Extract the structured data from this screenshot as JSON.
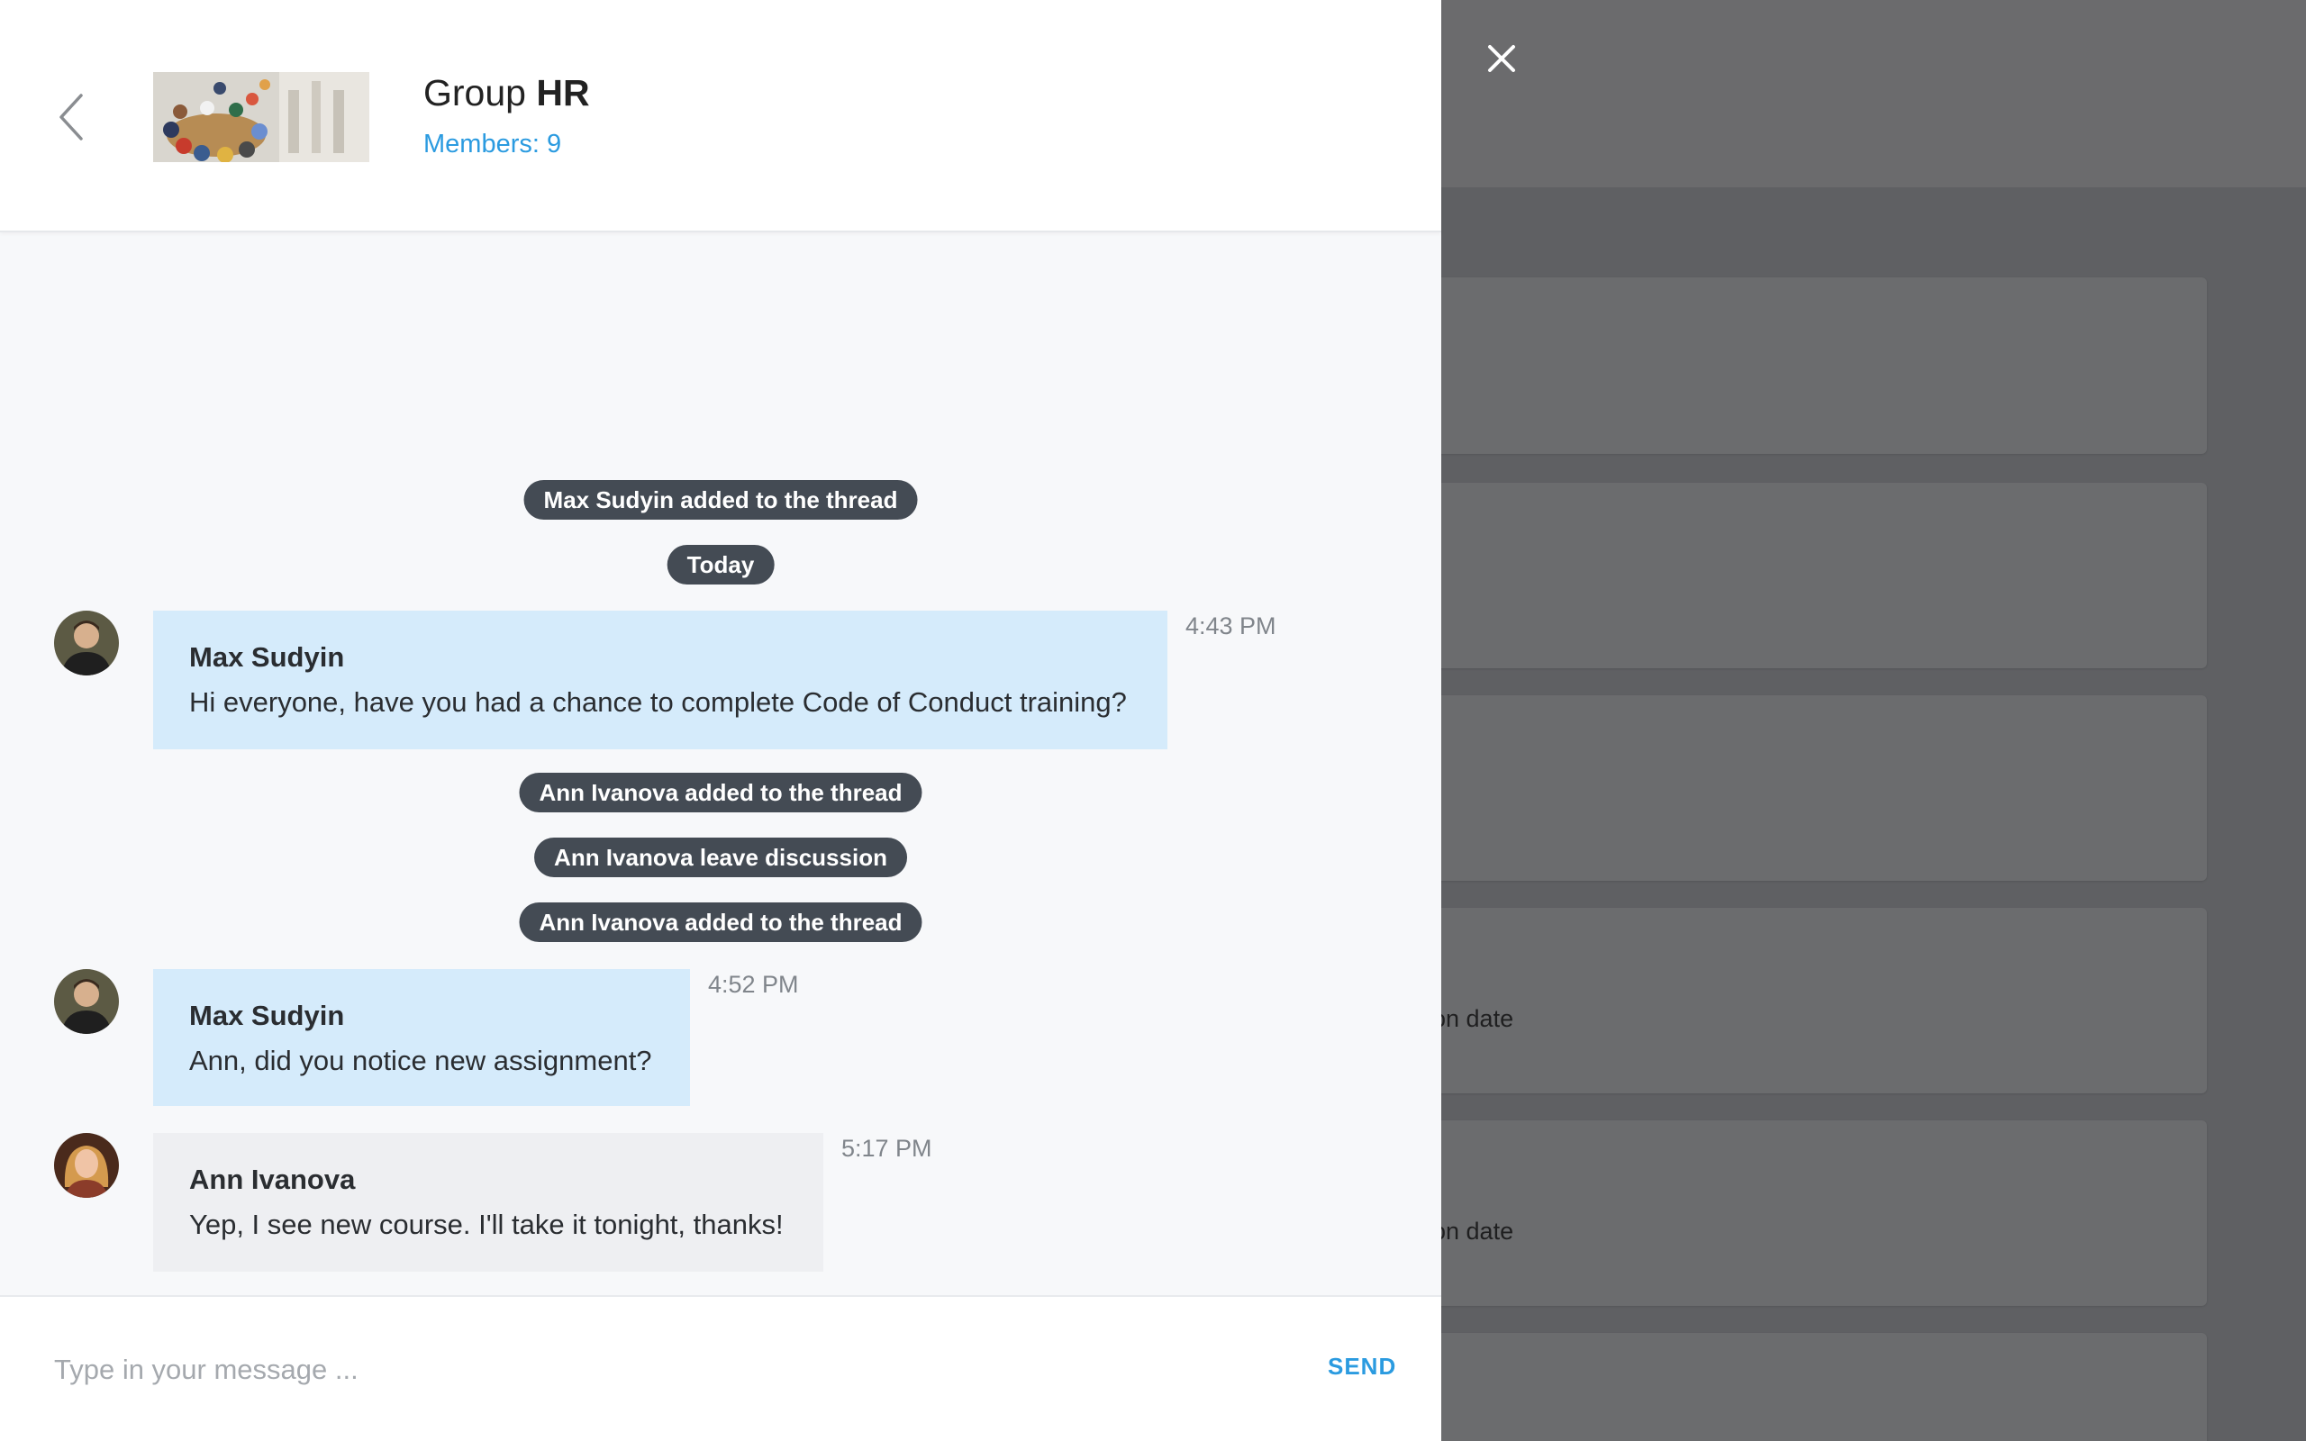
{
  "header": {
    "title_prefix": "Group",
    "title_name": "HR",
    "members": "Members: 9"
  },
  "events": [
    "Max Sudyin added to the thread",
    "Today",
    "Ann Ivanova added to the thread",
    "Ann Ivanova leave discussion",
    "Ann Ivanova added to the thread"
  ],
  "messages": [
    {
      "author": "Max Sudyin",
      "text": "Hi everyone, have you had a chance to complete Code of Conduct training?",
      "time": "4:43 PM"
    },
    {
      "author": "Max Sudyin",
      "text": "Ann, did you notice new assignment?",
      "time": "4:52 PM"
    },
    {
      "author": "Ann Ivanova",
      "text": "Yep, I see new course. I'll take it tonight, thanks!",
      "time": "5:17 PM"
    }
  ],
  "composer": {
    "placeholder": "Type in your message ...",
    "send_label": "SEND"
  },
  "background": {
    "card_fragments": [
      "on date",
      "on date"
    ]
  },
  "colors": {
    "accent": "#2b9be0",
    "my_bubble": "#d5ebfb",
    "other_bubble": "#eeeff2",
    "system_pill": "#444b54"
  }
}
